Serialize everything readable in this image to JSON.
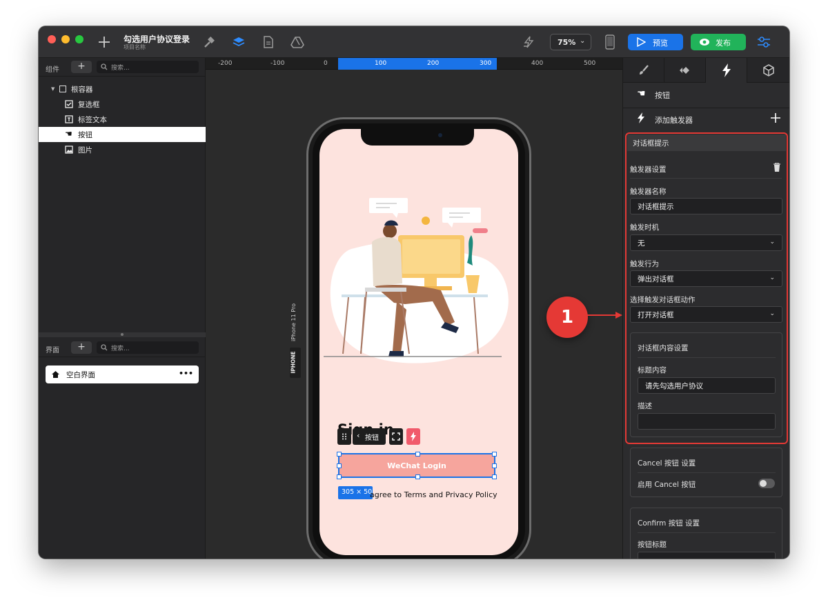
{
  "titlebar": {
    "project_title": "勾选用户协议登录",
    "project_subtitle": "项目名称",
    "zoom": "75%",
    "preview_label": "预览",
    "publish_label": "发布"
  },
  "left_panel": {
    "components_label": "组件",
    "search_placeholder": "搜索...",
    "tree": {
      "root": "根容器",
      "items": [
        "复选框",
        "标签文本",
        "按钮",
        "图片"
      ]
    },
    "screens_label": "界面",
    "screens_search_placeholder": "搜索...",
    "screens": [
      {
        "name": "空白界面",
        "menu": "•••"
      }
    ]
  },
  "ruler": {
    "ticks": [
      "-200",
      "-100",
      "0",
      "100",
      "200",
      "300",
      "400",
      "500"
    ]
  },
  "canvas": {
    "device_label": "iPhone 11 Pro",
    "device_tag": "IPHONE",
    "signin_text": "Sign in",
    "toolbar_button_label": "按钮",
    "wechat_button": "WeChat Login",
    "size_badge": "305 × 50",
    "agree_text": "agree to Terms and Privacy Policy"
  },
  "callout": {
    "number": "1"
  },
  "right_panel": {
    "selected_component": "按钮",
    "add_trigger": "添加触发器",
    "trigger_header": "对话框提示",
    "trigger_settings": "触发器设置",
    "trigger_name_label": "触发器名称",
    "trigger_name_value": "对话框提示",
    "trigger_timing_label": "触发时机",
    "trigger_timing_value": "无",
    "trigger_action_label": "触发行为",
    "trigger_action_value": "弹出对话框",
    "dialog_action_label": "选择触发对话框动作",
    "dialog_action_value": "打开对话框",
    "dialog_content_settings": "对话框内容设置",
    "title_content_label": "标题内容",
    "title_content_value": "请先勾选用户协议",
    "description_label": "描述",
    "description_value": "",
    "cancel_settings": "Cancel 按钮 设置",
    "enable_cancel": "启用 Cancel 按钮",
    "confirm_settings": "Confirm 按钮 设置",
    "button_title_label": "按钮标题"
  },
  "colors": {
    "accent_blue": "#1a73e8",
    "publish_green": "#21b35a",
    "highlight_red": "#e53935",
    "phone_screen": "#fde3de",
    "wechat_button": "#f6a59d"
  }
}
